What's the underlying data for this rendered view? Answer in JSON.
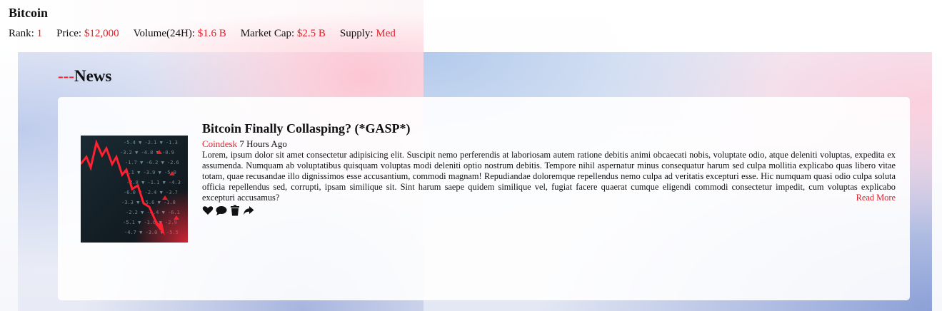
{
  "coin": {
    "name": "Bitcoin",
    "stats": [
      {
        "label": "Rank:",
        "value": "1"
      },
      {
        "label": "Price:",
        "value": "$12,000"
      },
      {
        "label": "Volume(24H):",
        "value": "$1.6 B"
      },
      {
        "label": "Market Cap:",
        "value": "$2.5 B"
      },
      {
        "label": "Supply:",
        "value": "Med"
      }
    ]
  },
  "news": {
    "heading_prefix": "---",
    "heading": "News",
    "articles": [
      {
        "title": "Bitcoin Finally Collasping? (*GASP*)",
        "source": "Coindesk",
        "time": "7 Hours Ago",
        "body": "Lorem, ipsum dolor sit amet consectetur adipisicing elit. Suscipit nemo perferendis at laboriosam autem ratione debitis animi obcaecati nobis, voluptate odio, atque deleniti voluptas, expedita ex assumenda. Numquam ab voluptatibus quisquam voluptas modi deleniti optio nostrum debitis. Tempore nihil aspernatur minus consequatur harum sed culpa mollitia explicabo quas libero vitae totam, quae recusandae illo dignissimos esse accusantium, commodi magnam! Repudiandae doloremque repellendus nemo culpa ad veritatis excepturi esse. Hic numquam quasi odio culpa soluta officia repellendus sed, corrupti, ipsam similique sit. Sint harum saepe quidem similique vel, fugiat facere quaerat cumque eligendi commodi consectetur impedit, cum voluptas explicabo excepturi accusamus?",
        "read_more": "Read More",
        "image_icon": "falling-stock-chart-image",
        "actions": [
          "heart-icon",
          "comment-icon",
          "trash-icon",
          "share-icon"
        ]
      }
    ]
  },
  "colors": {
    "accent": "#e3202a",
    "text": "#111111",
    "card": "#ffffff"
  }
}
